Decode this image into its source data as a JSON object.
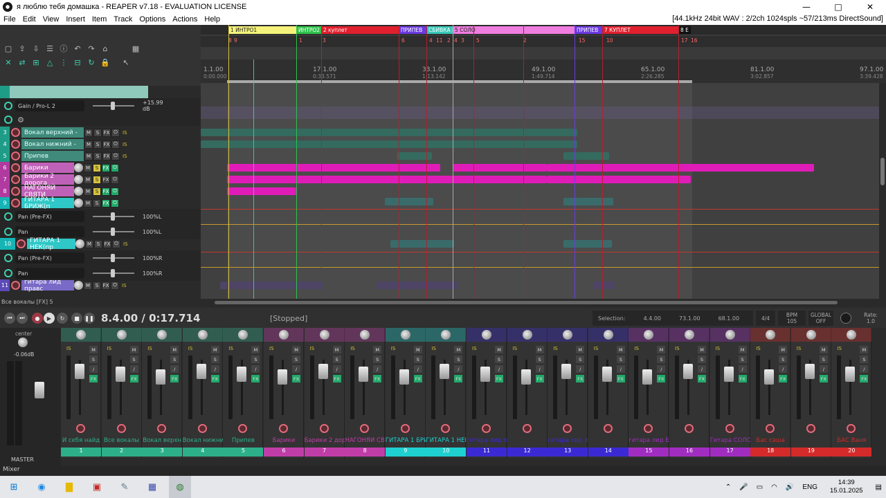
{
  "window": {
    "title": "я люблю тебя домашка - REAPER v7.18 - EVALUATION LICENSE",
    "min_glyph": "—",
    "max_glyph": "□",
    "close_glyph": "✕"
  },
  "menu": {
    "items": [
      "File",
      "Edit",
      "View",
      "Insert",
      "Item",
      "Track",
      "Options",
      "Actions",
      "Help"
    ],
    "status": "[44.1kHz 24bit WAV : 2/2ch 1024spls ~57/213ms DirectSound]"
  },
  "regions": [
    {
      "label": "1  ИНТРО1",
      "color": "#f4f27a",
      "text": "#222"
    },
    {
      "label": "ИНТРО2",
      "color": "#2ec24a",
      "text": "#fff"
    },
    {
      "label": "2  куплет",
      "color": "#e0202e",
      "text": "#fff"
    },
    {
      "label": "ПРИПЕВ",
      "color": "#6b3ae0",
      "text": "#fff"
    },
    {
      "label": "СБИВКА П",
      "color": "#37c7b8",
      "text": "#fff"
    },
    {
      "label": "5  СОЛО",
      "color": "#f07de0",
      "text": "#222"
    },
    {
      "label": "ПРИПЕВ",
      "color": "#6b3ae0",
      "text": "#fff"
    },
    {
      "label": "7  КУПЛЕТ",
      "color": "#e0202e",
      "text": "#fff"
    },
    {
      "label": "8 Е",
      "color": "#111",
      "text": "#fff"
    }
  ],
  "markers": [
    "8",
    "9",
    "1",
    "3",
    "6",
    "4",
    "11",
    "2",
    "4",
    "3",
    "5",
    "2",
    "15",
    "10",
    "17",
    "16"
  ],
  "ruler": [
    {
      "bar": "1.1.00",
      "time": "0:00.000"
    },
    {
      "bar": "17.1.00",
      "time": "0:33.571"
    },
    {
      "bar": "33.1.00",
      "time": "1:13.142"
    },
    {
      "bar": "49.1.00",
      "time": "1:49.714"
    },
    {
      "bar": "65.1.00",
      "time": "2:26.285"
    },
    {
      "bar": "81.1.00",
      "time": "3:02.857"
    },
    {
      "bar": "97.1.00",
      "time": "3:39.428"
    }
  ],
  "tcp": {
    "envelopes": [
      {
        "name": "Gain / Pro-L 2",
        "value": "+15.99 dB"
      },
      {
        "name": "Pan (Pre-FX)",
        "value": "100%L"
      },
      {
        "name": "Pan",
        "value": "100%L"
      },
      {
        "name": "Pan (Pre-FX)",
        "value": "100%R"
      },
      {
        "name": "Pan",
        "value": "100%R"
      }
    ],
    "tracks": [
      {
        "num": "3",
        "name": "Вокал верхний -",
        "color": "#3f8a7a"
      },
      {
        "num": "4",
        "name": "Вокал нижний -",
        "color": "#3f8a7a"
      },
      {
        "num": "5",
        "name": "Припев",
        "color": "#3f8a7a"
      },
      {
        "num": "6",
        "name": "Барики",
        "color": "#c061b8"
      },
      {
        "num": "7",
        "name": "Барики 2 дорога",
        "color": "#c061b8"
      },
      {
        "num": "8",
        "name": "НАГОНЯЙ СВЯТИ",
        "color": "#c061b8"
      },
      {
        "num": "9",
        "name": "ГИТАРА 1 БРИЖ(п",
        "color": "#2fc7c7"
      },
      {
        "num": "10",
        "name": "ГИТАРА 1 НЕК(пр",
        "color": "#2fc7c7"
      },
      {
        "num": "11",
        "name": "гитара лид правс",
        "color": "#7a6ac7"
      }
    ],
    "io_label": "IS",
    "mute_label": "M",
    "solo_label": "S",
    "fx_label": "FX"
  },
  "statusline": "Все вокалы [FX] 5",
  "transport": {
    "time": "8.4.00 / 0:17.714",
    "state": "[Stopped]",
    "selection_label": "Selection:",
    "sel_start": "4.4.00",
    "sel_end": "73.1.00",
    "sel_length": "68.1.00",
    "timesig": "4/4",
    "bpm_label": "BPM",
    "bpm": "105",
    "global_label": "GLOBAL",
    "global_state": "OFF",
    "rate_label": "Rate:",
    "rate": "1.0"
  },
  "mixer": {
    "label": "Mixer",
    "master_label": "MASTER",
    "master_center": "center",
    "master_db": "-0.06dB",
    "strips": [
      {
        "name": "И себя найд",
        "num": "1",
        "color": "#2db08a"
      },
      {
        "name": "Все вокалы",
        "num": "2",
        "color": "#2db08a"
      },
      {
        "name": "Вокал верхн",
        "num": "3",
        "color": "#2db08a"
      },
      {
        "name": "Вокал нижни",
        "num": "4",
        "color": "#2db08a"
      },
      {
        "name": "Припев",
        "num": "5",
        "color": "#2db08a"
      },
      {
        "name": "Барики",
        "num": "6",
        "color": "#c03da8"
      },
      {
        "name": "Барики 2 дор",
        "num": "7",
        "color": "#c03da8"
      },
      {
        "name": "НАГОНЯЙ СВ",
        "num": "8",
        "color": "#c03da8"
      },
      {
        "name": "ГИТАРА 1 БРИ",
        "num": "9",
        "color": "#1fd0d0"
      },
      {
        "name": "ГИТАРА 1 НЕК",
        "num": "10",
        "color": "#1fd0d0"
      },
      {
        "name": "гитара лид п",
        "num": "11",
        "color": "#3b2ad4"
      },
      {
        "name": "",
        "num": "12",
        "color": "#3b2ad4"
      },
      {
        "name": "гитара лид л",
        "num": "13",
        "color": "#3b2ad4"
      },
      {
        "name": "",
        "num": "14",
        "color": "#3b2ad4"
      },
      {
        "name": "гитара лид Б",
        "num": "15",
        "color": "#a02dc0"
      },
      {
        "name": "",
        "num": "16",
        "color": "#a02dc0"
      },
      {
        "name": "Гитара СОЛО",
        "num": "17",
        "color": "#a02dc0"
      },
      {
        "name": "Бас саша",
        "num": "18",
        "color": "#d42a2a"
      },
      {
        "name": "",
        "num": "19",
        "color": "#d42a2a"
      },
      {
        "name": "БАС Ваня",
        "num": "20",
        "color": "#d42a2a"
      }
    ]
  },
  "taskbar": {
    "lang": "ENG",
    "time": "14:39",
    "date": "15.01.2025"
  }
}
